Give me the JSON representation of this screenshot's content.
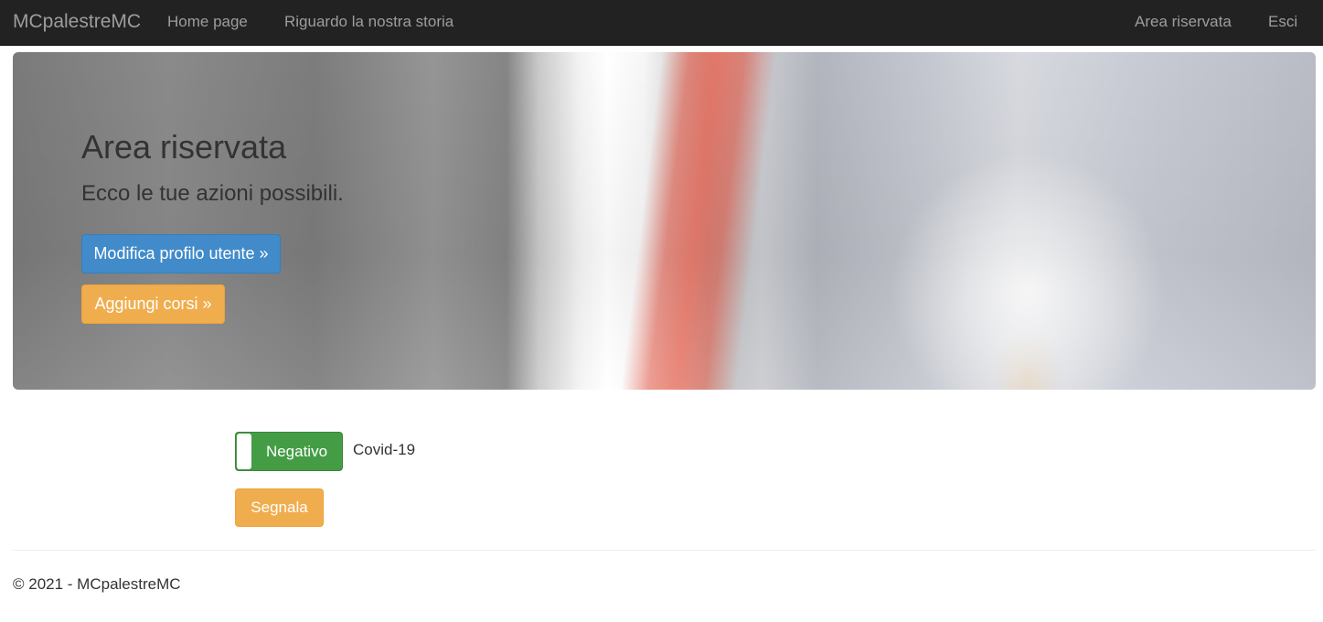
{
  "navbar": {
    "brand": "MCpalestreMC",
    "left_links": [
      {
        "label": "Home page"
      },
      {
        "label": "Riguardo la nostra storia"
      }
    ],
    "right_links": [
      {
        "label": "Area riservata"
      },
      {
        "label": "Esci"
      }
    ]
  },
  "hero": {
    "title": "Area riservata",
    "subtitle": "Ecco le tue azioni possibili.",
    "buttons": [
      {
        "label": "Modifica profilo utente »",
        "color": "#428bca"
      },
      {
        "label": "Aggiungi corsi »",
        "color": "#f0ad4e"
      }
    ]
  },
  "covid": {
    "toggle_label": "Negativo",
    "toggle_on": true,
    "toggle_color": "#449d44",
    "field_label": "Covid-19",
    "report_button": "Segnala",
    "report_button_color": "#f0ad4e"
  },
  "footer": {
    "text": "© 2021 - MCpalestreMC"
  },
  "colors": {
    "navbar_bg": "#222222",
    "nav_text": "#9d9d9d"
  }
}
